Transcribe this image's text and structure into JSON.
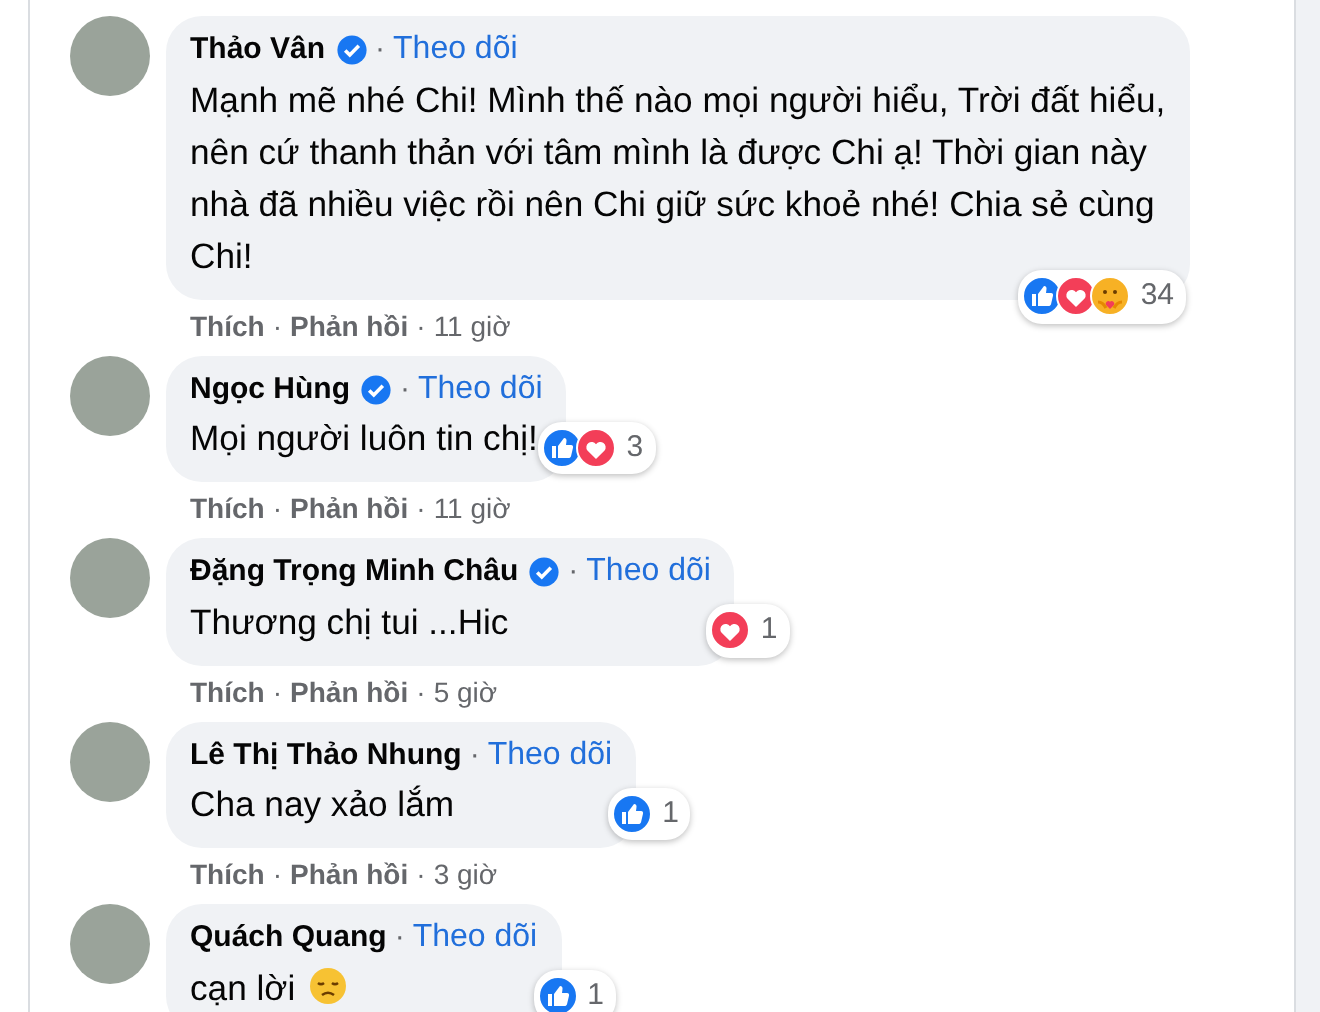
{
  "comments": [
    {
      "author": "Thảo Vân",
      "verified": true,
      "follow_separator": "·",
      "follow": "Theo dõi",
      "text": "Mạnh mẽ nhé Chi! Mình thế nào mọi người hiểu, Trời đất hiểu, nên cứ thanh thản với tâm mình là được Chi ạ! Thời gian này nhà đã nhiều việc rồi nên Chi giữ sức khoẻ nhé! Chia sẻ cùng Chi!",
      "reactions": {
        "icons": [
          {
            "kind": "like"
          },
          {
            "kind": "love"
          },
          {
            "kind": "care"
          }
        ],
        "count": "34"
      },
      "meta": [
        {
          "kind": "action",
          "text": "Thích"
        },
        {
          "kind": "dot",
          "text": "·"
        },
        {
          "kind": "action",
          "text": "Phản hồi"
        },
        {
          "kind": "dot",
          "text": "·"
        },
        {
          "kind": "time",
          "text": "11 giờ"
        }
      ]
    },
    {
      "author": "Ngọc Hùng",
      "verified": true,
      "follow_separator": "·",
      "follow": "Theo dõi",
      "text": "Mọi người luôn tin chị!",
      "reactions": {
        "icons": [
          {
            "kind": "like"
          },
          {
            "kind": "love"
          }
        ],
        "count": "3"
      },
      "meta": [
        {
          "kind": "action",
          "text": "Thích"
        },
        {
          "kind": "dot",
          "text": "·"
        },
        {
          "kind": "action",
          "text": "Phản hồi"
        },
        {
          "kind": "dot",
          "text": "·"
        },
        {
          "kind": "time",
          "text": "11 giờ"
        }
      ]
    },
    {
      "author": "Đặng Trọng Minh Châu",
      "verified": true,
      "follow_separator": "·",
      "follow": "Theo dõi",
      "text": "Thương chị tui ...Hic",
      "reactions": {
        "icons": [
          {
            "kind": "love"
          }
        ],
        "count": "1"
      },
      "meta": [
        {
          "kind": "action",
          "text": "Thích"
        },
        {
          "kind": "dot",
          "text": "·"
        },
        {
          "kind": "action",
          "text": "Phản hồi"
        },
        {
          "kind": "dot",
          "text": "·"
        },
        {
          "kind": "time",
          "text": "5 giờ"
        }
      ]
    },
    {
      "author": "Lê Thị Thảo Nhung",
      "verified": false,
      "follow_separator": "·",
      "follow": "Theo dõi",
      "text": "Cha nay xảo lắm",
      "reactions": {
        "icons": [
          {
            "kind": "like"
          }
        ],
        "count": "1"
      },
      "meta": [
        {
          "kind": "action",
          "text": "Thích"
        },
        {
          "kind": "dot",
          "text": "·"
        },
        {
          "kind": "action",
          "text": "Phản hồi"
        },
        {
          "kind": "dot",
          "text": "·"
        },
        {
          "kind": "time",
          "text": "3 giờ"
        }
      ]
    },
    {
      "author": "Quách Quang",
      "verified": false,
      "follow_separator": "·",
      "follow": "Theo dõi",
      "text": "cạn lời",
      "trailing_icon": {
        "kind": "sad-face"
      },
      "reactions": {
        "icons": [
          {
            "kind": "like"
          }
        ],
        "count": "1"
      }
    }
  ]
}
